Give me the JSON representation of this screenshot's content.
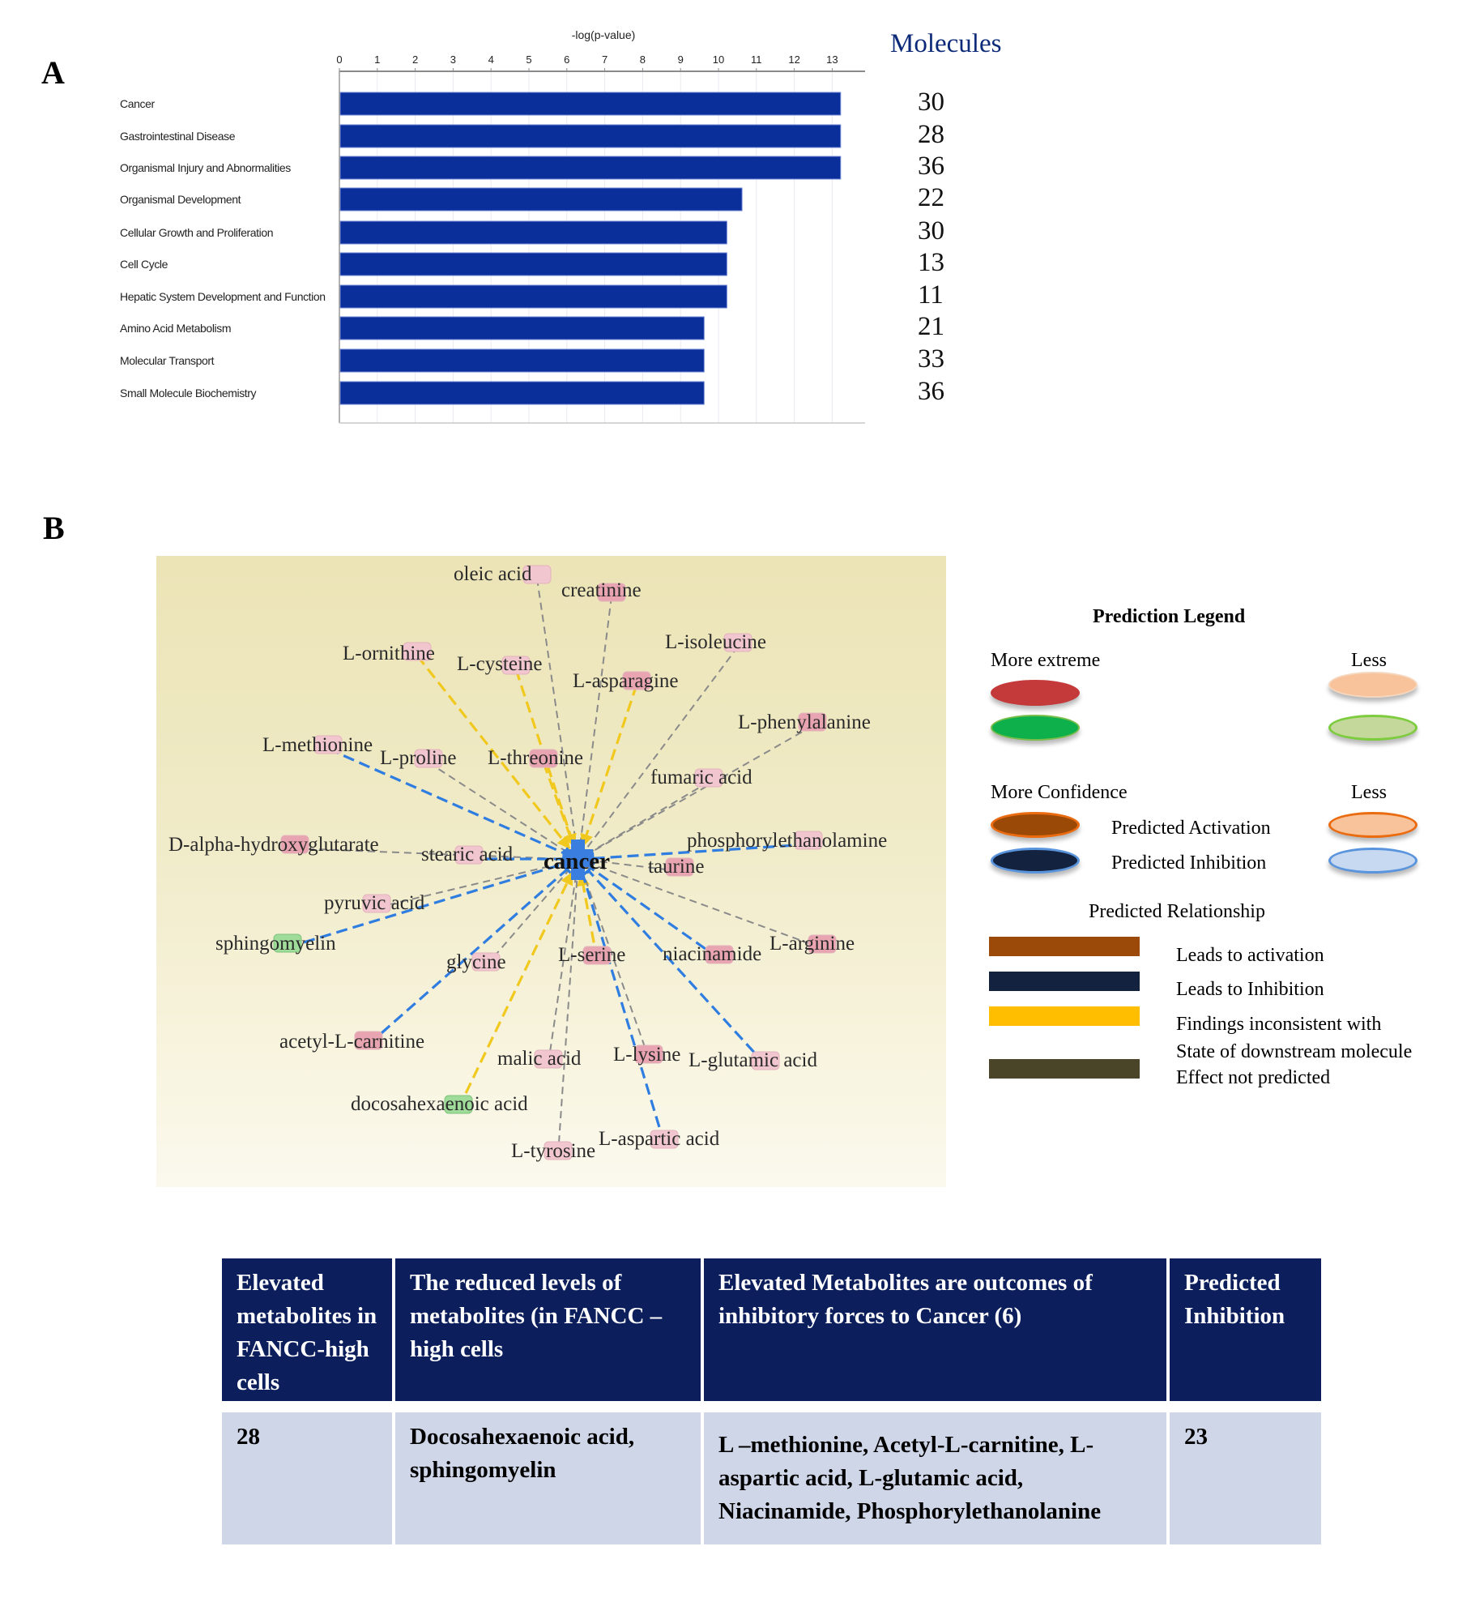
{
  "panel_a": {
    "label": "A",
    "molecules_header": "Molecules"
  },
  "panel_b": {
    "label": "B"
  },
  "chart_data": [
    {
      "type": "bar",
      "orientation": "horizontal",
      "title": "",
      "xlabel": "-log(p-value)",
      "ylabel": "",
      "xlim": [
        0,
        13.5
      ],
      "xticks": [
        0,
        1,
        2,
        3,
        4,
        5,
        6,
        7,
        8,
        9,
        10,
        11,
        12,
        13
      ],
      "grid": true,
      "categories": [
        "Cancer",
        "Gastrointestinal Disease",
        "Organismal Injury and Abnormalities",
        "Organismal Development",
        "Cellular Growth and Proliferation",
        "Cell Cycle",
        "Hepatic System Development and Function",
        "Amino Acid Metabolism",
        "Molecular Transport",
        "Small Molecule Biochemistry"
      ],
      "values": [
        13.2,
        13.2,
        13.2,
        10.6,
        10.2,
        10.2,
        10.2,
        9.6,
        9.6,
        9.6
      ],
      "molecules": [
        30,
        28,
        36,
        22,
        30,
        13,
        11,
        21,
        33,
        36
      ],
      "bar_color": "#0a2f9a"
    }
  ],
  "network": {
    "center": "cancer",
    "edge_colors": {
      "inhibition": "#2f7de0",
      "inconsistent": "#f0c81e",
      "not_predicted": "#8a8a8a"
    },
    "node_colors": {
      "up": "#f2c6cf",
      "up_strong": "#e8a4b0",
      "down": "#9fdc9a"
    },
    "nodes": [
      {
        "label": "oleic acid",
        "edge": "not_predicted",
        "kind": "up"
      },
      {
        "label": "creatinine",
        "edge": "not_predicted",
        "kind": "up_strong"
      },
      {
        "label": "L-ornithine",
        "edge": "inconsistent",
        "kind": "up"
      },
      {
        "label": "L-cysteine",
        "edge": "inconsistent",
        "kind": "up"
      },
      {
        "label": "L-isoleucine",
        "edge": "not_predicted",
        "kind": "up"
      },
      {
        "label": "L-asparagine",
        "edge": "inconsistent",
        "kind": "up_strong"
      },
      {
        "label": "L-phenylalanine",
        "edge": "not_predicted",
        "kind": "up_strong"
      },
      {
        "label": "L-methionine",
        "edge": "inhibition",
        "kind": "up"
      },
      {
        "label": "L-proline",
        "edge": "not_predicted",
        "kind": "up"
      },
      {
        "label": "L-threonine",
        "edge": "inconsistent",
        "kind": "up_strong"
      },
      {
        "label": "fumaric acid",
        "edge": "not_predicted",
        "kind": "up"
      },
      {
        "label": "D-alpha-hydroxyglutarate",
        "edge": "not_predicted",
        "kind": "up_strong"
      },
      {
        "label": "stearic acid",
        "edge": "inhibition",
        "kind": "up"
      },
      {
        "label": "phosphorylethanolamine",
        "edge": "inhibition",
        "kind": "up"
      },
      {
        "label": "taurine",
        "edge": "not_predicted",
        "kind": "up_strong"
      },
      {
        "label": "pyruvic acid",
        "edge": "not_predicted",
        "kind": "up"
      },
      {
        "label": "sphingomyelin",
        "edge": "inhibition",
        "kind": "down"
      },
      {
        "label": "glycine",
        "edge": "not_predicted",
        "kind": "up"
      },
      {
        "label": "L-serine",
        "edge": "inconsistent",
        "kind": "up_strong"
      },
      {
        "label": "niacinamide",
        "edge": "inhibition",
        "kind": "up_strong"
      },
      {
        "label": "L-arginine",
        "edge": "not_predicted",
        "kind": "up_strong"
      },
      {
        "label": "acetyl-L-carnitine",
        "edge": "inhibition",
        "kind": "up_strong"
      },
      {
        "label": "malic acid",
        "edge": "not_predicted",
        "kind": "up"
      },
      {
        "label": "L-lysine",
        "edge": "not_predicted",
        "kind": "up_strong"
      },
      {
        "label": "L-glutamic acid",
        "edge": "inhibition",
        "kind": "up"
      },
      {
        "label": "docosahexaenoic acid",
        "edge": "inconsistent",
        "kind": "down"
      },
      {
        "label": "L-tyrosine",
        "edge": "not_predicted",
        "kind": "up"
      },
      {
        "label": "L-aspartic acid",
        "edge": "inhibition",
        "kind": "up"
      }
    ]
  },
  "legend": {
    "title": "Prediction Legend",
    "more_extreme": "More extreme",
    "less_1": "Less",
    "more_confidence": "More  Confidence",
    "less_2": "Less",
    "predicted_activation": "Predicted Activation",
    "predicted_inhibition": "Predicted  Inhibition",
    "relationship_title": "Predicted  Relationship",
    "rel_activation": "Leads to activation",
    "rel_inhibition": "Leads to Inhibition",
    "rel_inconsistent_1": "Findings inconsistent  with",
    "rel_inconsistent_2": "State of downstream molecule",
    "rel_not_predicted": "Effect not predicted",
    "colors": {
      "extreme_up": "#c43a3a",
      "extreme_down": "#0db04b",
      "less_up": "#f8c29a",
      "less_down": "#c3d89a",
      "conf_activation": "#9a4a06",
      "conf_inhibition": "#13233f",
      "less_activation": "#f8c29a",
      "less_inhibition": "#c6d9f1",
      "rel_activation": "#9b4a09",
      "rel_inhibition": "#12223f",
      "rel_inconsistent": "#ffbf00",
      "rel_not_predicted": "#4a4529"
    }
  },
  "table": {
    "headers": [
      "Elevated metabolites in FANCC-high cells",
      "The reduced levels of metabolites (in FANCC –high cells",
      "Elevated Metabolites are outcomes of inhibitory forces to Cancer (6)",
      "Predicted Inhibition"
    ],
    "rows": [
      [
        "28",
        "Docosahexaenoic acid, sphingomyelin",
        "L –methionine, Acetyl-L-carnitine, L-aspartic acid, L-glutamic acid, Niacinamide, Phosphorylethanolanine",
        "23"
      ]
    ]
  }
}
